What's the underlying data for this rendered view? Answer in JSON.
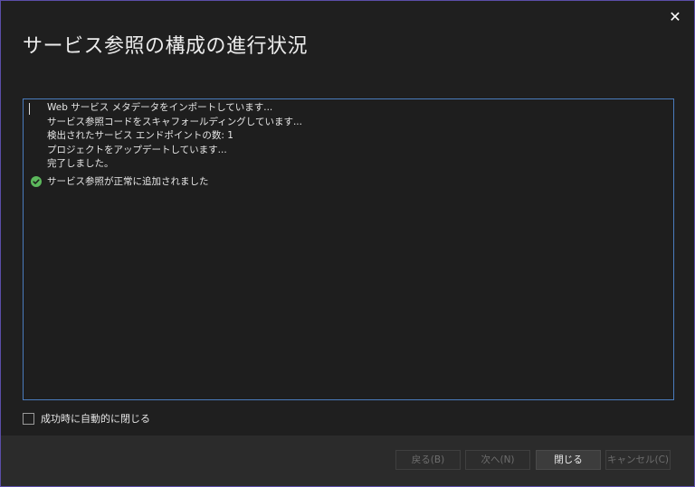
{
  "dialog": {
    "title": "サービス参照の構成の進行状況",
    "close_glyph": "✕"
  },
  "log": {
    "lines": [
      "Web サービス メタデータをインポートしています...",
      "サービス参照コードをスキャフォールディングしています...",
      "検出されたサービス エンドポイントの数: 1",
      "プロジェクトをアップデートしています...",
      "完了しました。"
    ],
    "success_message": "サービス参照が正常に追加されました",
    "success_icon": "check-circle-icon",
    "success_color": "#5cb85c"
  },
  "options": {
    "auto_close_label": "成功時に自動的に閉じる",
    "auto_close_checked": false
  },
  "buttons": {
    "back": "戻る(B)",
    "next": "次へ(N)",
    "close": "閉じる",
    "cancel": "キャンセル(C)"
  },
  "colors": {
    "accent_border": "#4a7cbd",
    "window_border": "#5b4ea8"
  }
}
